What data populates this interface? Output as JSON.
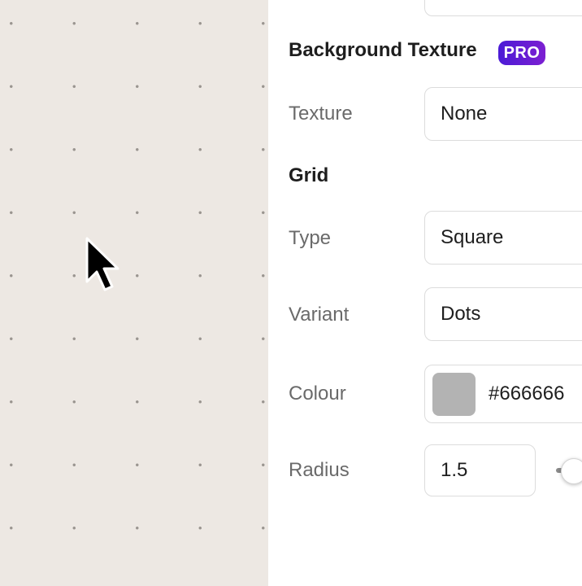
{
  "background_texture": {
    "title": "Background Texture",
    "badge": "PRO",
    "texture_label": "Texture",
    "texture_value": "None"
  },
  "grid": {
    "title": "Grid",
    "type_label": "Type",
    "type_value": "Square",
    "variant_label": "Variant",
    "variant_value": "Dots",
    "colour_label": "Colour",
    "colour_value": "#666666",
    "radius_label": "Radius",
    "radius_value": "1.5"
  },
  "colors": {
    "canvas_background": "#ede8e3",
    "grid_dot": "#9a9590",
    "swatch_display": "#b3b3b3",
    "badge_gradient_start": "#4b1bd6",
    "badge_gradient_end": "#7c1fd1"
  },
  "icons": {
    "cursor": "arrow-cursor-icon"
  }
}
